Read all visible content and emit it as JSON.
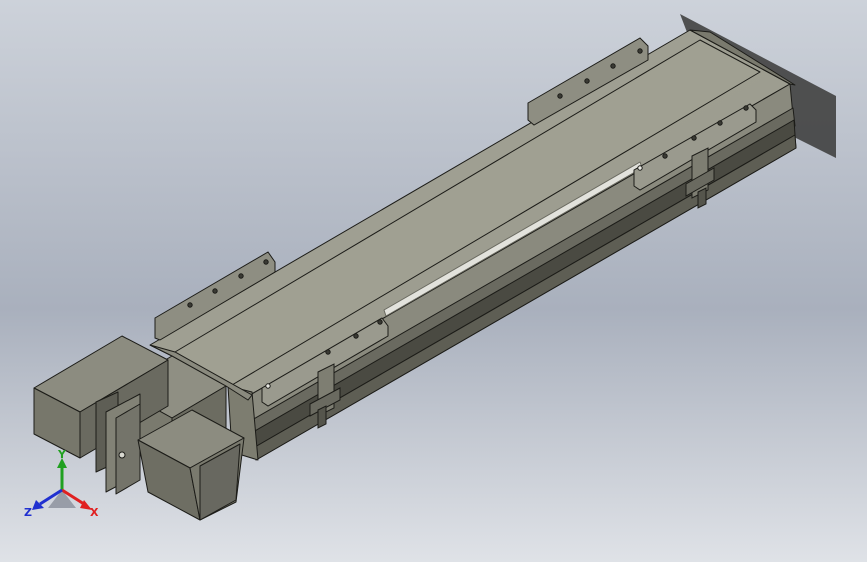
{
  "viewport": {
    "background_top": "#cdd2da",
    "background_mid": "#a4acba",
    "background_bottom": "#dfe2e7"
  },
  "model": {
    "body_color": "#8c8c7e",
    "top_color": "#a2a294",
    "side_color": "#707064",
    "dark_color": "#45453d",
    "edge_color": "#1c1c18",
    "rail_color": "#d8d8d2",
    "motor_icon": "servo-motor-icon",
    "linear_module_icon": "linear-module-icon"
  },
  "triad": {
    "x_label": "X",
    "y_label": "Y",
    "z_label": "Z",
    "x_color": "#e02020",
    "y_color": "#20a020",
    "z_color": "#2030d0"
  }
}
